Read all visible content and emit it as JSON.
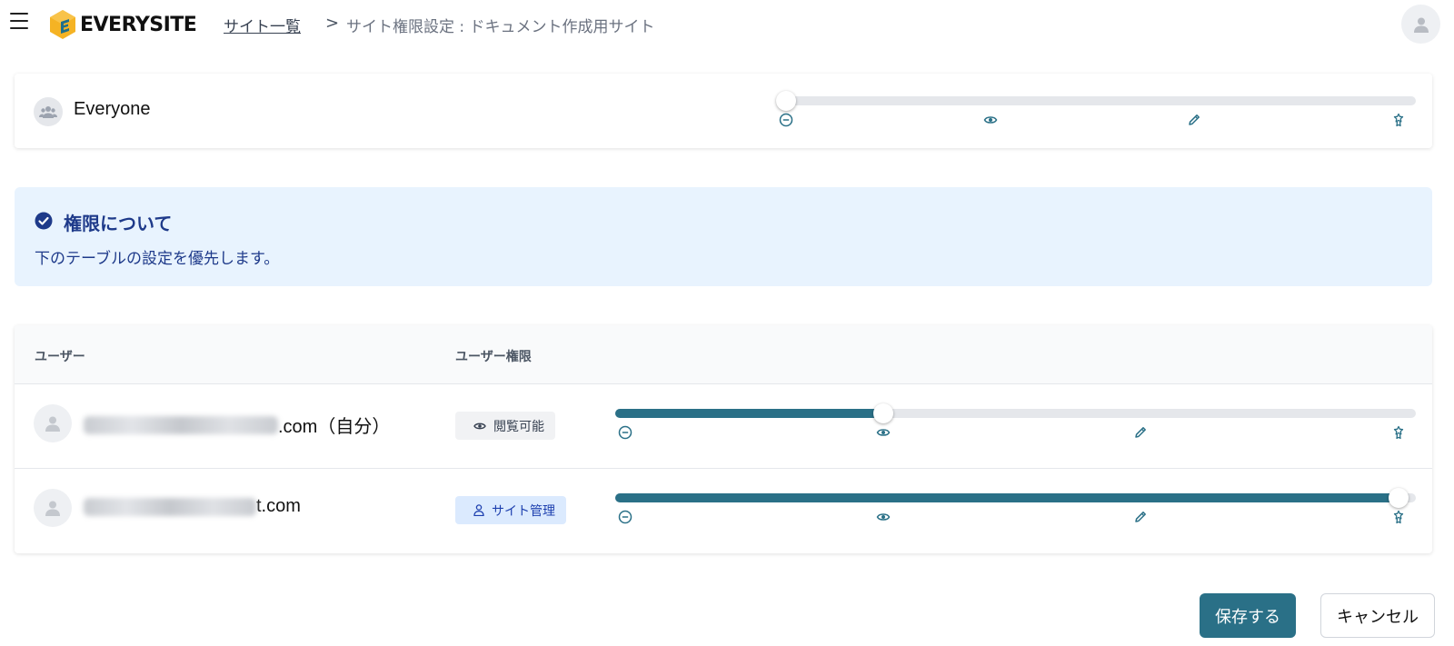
{
  "header": {
    "logo_text": "EVERYSITE",
    "breadcrumb_link": "サイト一覧",
    "breadcrumb_separator": ">",
    "breadcrumb_current": "サイト権限設定 : ドキュメント作成用サイト"
  },
  "everyone": {
    "label": "Everyone",
    "permission_level": 0
  },
  "permission_levels": [
    "none",
    "view",
    "edit",
    "admin"
  ],
  "info": {
    "title": "権限について",
    "body": "下のテーブルの設定を優先します。"
  },
  "table": {
    "columns": [
      "ユーザー",
      "ユーザー権限"
    ],
    "rows": [
      {
        "email_suffix": ".com（自分）",
        "badge": "閲覧可能",
        "badge_icon": "eye-icon",
        "permission_level": 1
      },
      {
        "email_suffix": "t.com",
        "badge": "サイト管理",
        "badge_icon": "user-icon",
        "permission_level": 3
      }
    ]
  },
  "footer": {
    "save_label": "保存する",
    "cancel_label": "キャンセル"
  },
  "colors": {
    "accent": "#2a7087",
    "info_bg": "#e8f3fe",
    "info_text": "#1e3a8a",
    "logo_yellow": "#f5b324",
    "logo_blue": "#1f6f8b"
  }
}
